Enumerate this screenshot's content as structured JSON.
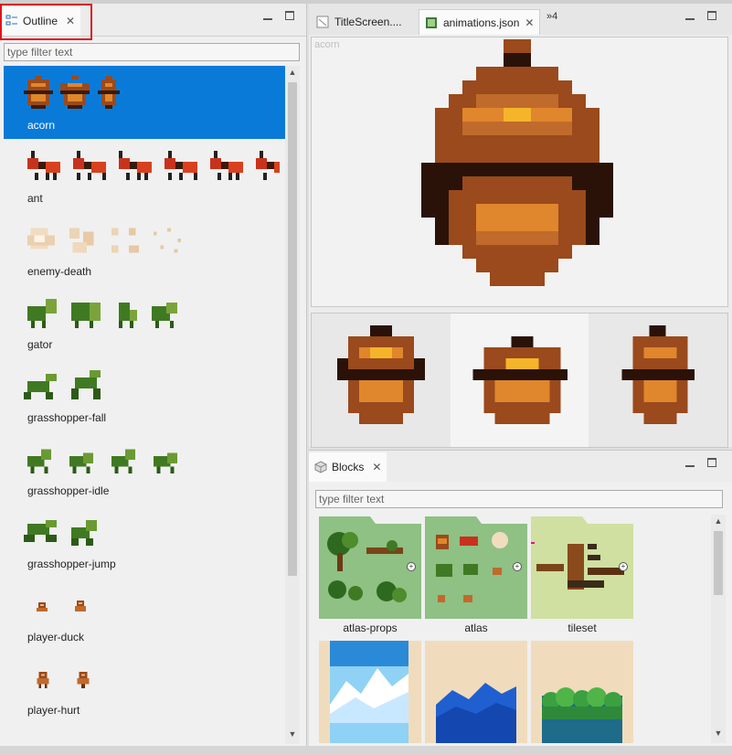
{
  "outline": {
    "tab_label": "Outline",
    "close_glyph": "✕",
    "filter_placeholder": "type filter text",
    "items": [
      {
        "label": "acorn",
        "selected": true
      },
      {
        "label": "ant"
      },
      {
        "label": "enemy-death"
      },
      {
        "label": "gator"
      },
      {
        "label": "grasshopper-fall"
      },
      {
        "label": "grasshopper-idle"
      },
      {
        "label": "grasshopper-jump"
      },
      {
        "label": "player-duck"
      },
      {
        "label": "player-hurt"
      }
    ]
  },
  "editor": {
    "tabs": [
      {
        "label": "TitleScreen...."
      },
      {
        "label": "animations.json",
        "active": true
      }
    ],
    "overflow_label": "»4",
    "close_glyph": "✕",
    "preview_name": "acorn"
  },
  "blocks": {
    "tab_label": "Blocks",
    "close_glyph": "✕",
    "filter_placeholder": "type filter text",
    "items": [
      {
        "label": "atlas-props"
      },
      {
        "label": "atlas"
      },
      {
        "label": "tileset"
      },
      {
        "label": ""
      },
      {
        "label": ""
      },
      {
        "label": ""
      }
    ]
  },
  "colors": {
    "selection": "#0a7ad8",
    "highlight_box": "#e0141b",
    "acorn_dark": "#3a1a0c",
    "acorn_mid": "#9a4a1c",
    "acorn_light": "#e0862c",
    "acorn_glow": "#f5b52a"
  }
}
